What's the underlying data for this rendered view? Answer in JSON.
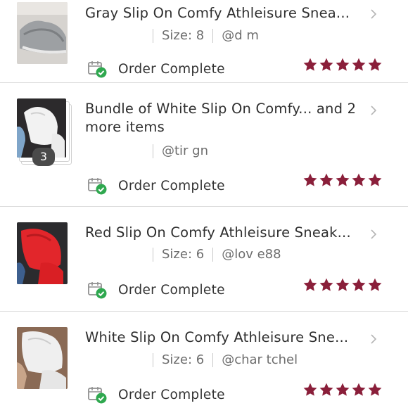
{
  "status_label": "Order Complete",
  "star_color": "#8a1f3a",
  "orders": [
    {
      "title": "Gray Slip On Comfy Athleisure Snea...",
      "size": "Size: 8",
      "username": "@d      m",
      "rating": 5
    },
    {
      "title": "Bundle of White Slip On Comfy... and 2 more items",
      "item_count": "3",
      "username": "@tir     gn",
      "rating": 5
    },
    {
      "title": "Red Slip On Comfy Athleisure Sneak...",
      "size": "Size: 6",
      "username": "@lov      e88",
      "rating": 5
    },
    {
      "title": "White Slip On Comfy Athleisure Sne...",
      "size": "Size: 6",
      "username": "@char      tchel",
      "rating": 5
    }
  ]
}
